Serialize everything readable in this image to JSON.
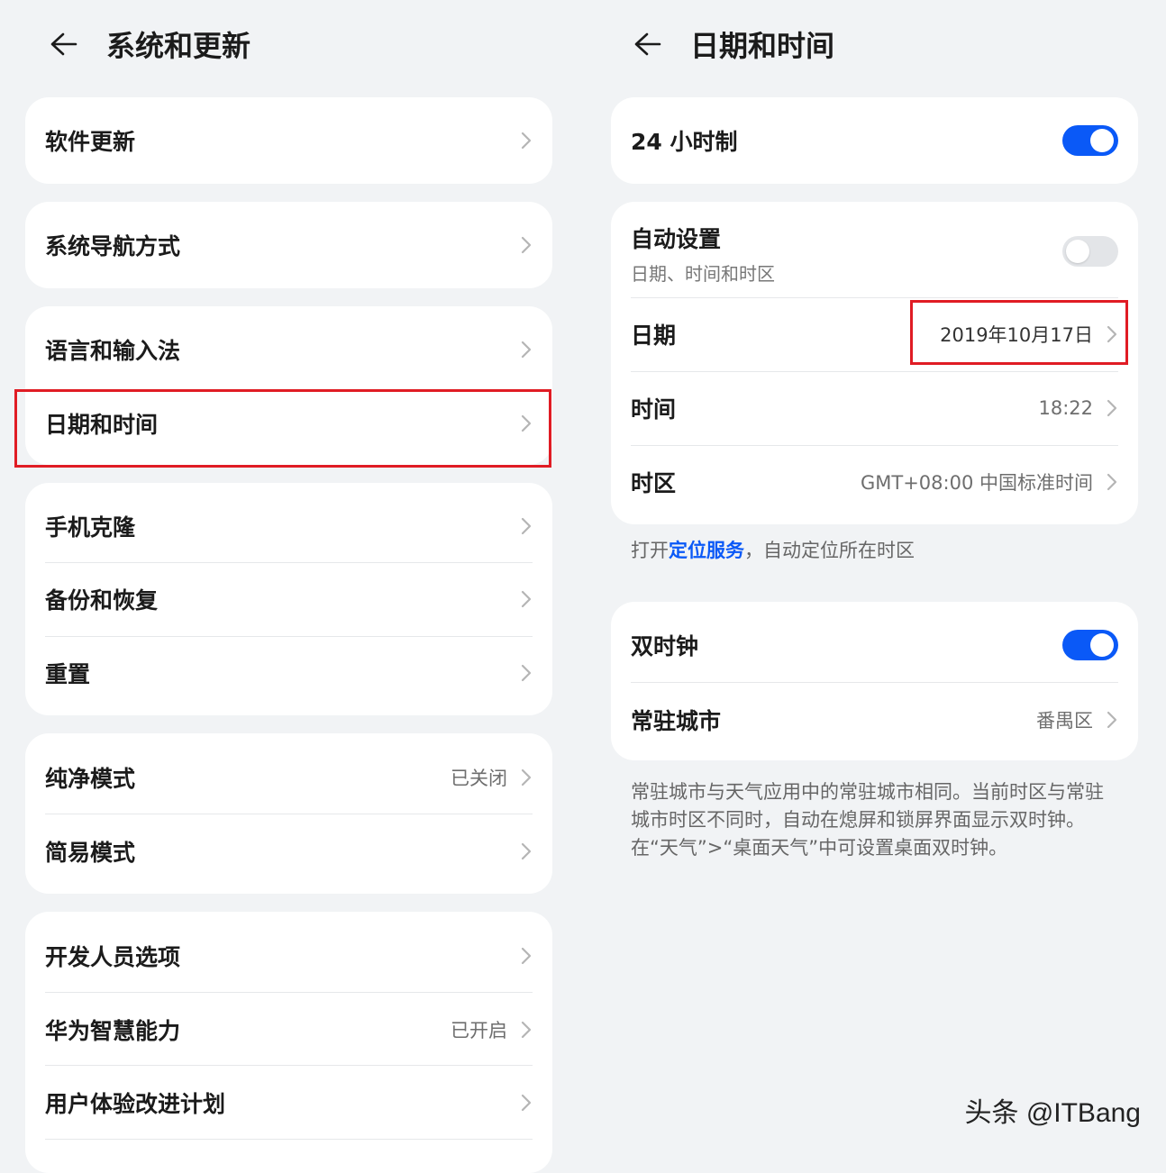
{
  "left": {
    "title": "系统和更新",
    "items": {
      "software_update": "软件更新",
      "navigation": "系统导航方式",
      "language": "语言和输入法",
      "date_time": "日期和时间",
      "phone_clone": "手机克隆",
      "backup": "备份和恢复",
      "reset": "重置",
      "pure_mode": "纯净模式",
      "pure_mode_value": "已关闭",
      "simple_mode": "简易模式",
      "developer": "开发人员选项",
      "huawei_ai": "华为智慧能力",
      "huawei_ai_value": "已开启",
      "ux_plan": "用户体验改进计划"
    }
  },
  "right": {
    "title": "日期和时间",
    "hour24": {
      "label": "24 小时制",
      "on": true
    },
    "auto": {
      "label": "自动设置",
      "sub": "日期、时间和时区",
      "on": false
    },
    "date": {
      "label": "日期",
      "value": "2019年10月17日"
    },
    "time": {
      "label": "时间",
      "value": "18:22"
    },
    "timezone": {
      "label": "时区",
      "value": "GMT+08:00 中国标准时间"
    },
    "location_note": {
      "prefix": "打开",
      "link": "定位服务",
      "suffix": "，自动定位所在时区"
    },
    "dual_clock": {
      "label": "双时钟",
      "on": true
    },
    "home_city": {
      "label": "常驻城市",
      "value": "番禺区"
    },
    "dual_note": "常驻城市与天气应用中的常驻城市相同。当前时区与常驻城市时区不同时，自动在熄屏和锁屏界面显示双时钟。在“天气”>“桌面天气”中可设置桌面双时钟。"
  },
  "watermark": "头条 @ITBang",
  "colors": {
    "accent": "#0a59f7",
    "highlight": "#e01c24",
    "background": "#f1f3f5",
    "card": "#ffffff"
  }
}
